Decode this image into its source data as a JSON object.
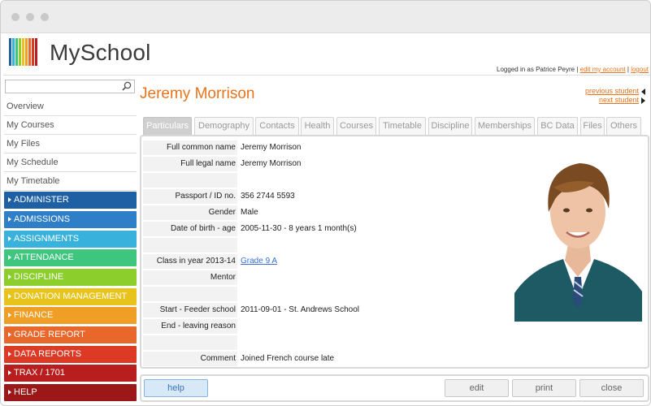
{
  "app": {
    "logo_text": "MySchool"
  },
  "header": {
    "logged_in_text": "Logged in as Patrice Peyre |",
    "edit_account_label": "edit my account",
    "separator": "|",
    "logout_label": "logout"
  },
  "sidebar": {
    "search": {
      "value": "",
      "placeholder": ""
    },
    "plain_items": [
      {
        "label": "Overview"
      },
      {
        "label": "My Courses"
      },
      {
        "label": "My Files"
      },
      {
        "label": "My Schedule"
      },
      {
        "label": "My Timetable"
      }
    ],
    "color_items": [
      {
        "label": "ADMINISTER",
        "color": "#1f5fa4"
      },
      {
        "label": "ADMISSIONS",
        "color": "#2f7fc8"
      },
      {
        "label": "ASSIGNMENTS",
        "color": "#38b2dc"
      },
      {
        "label": "ATTENDANCE",
        "color": "#3ec67f"
      },
      {
        "label": "DISCIPLINE",
        "color": "#8ccf2c"
      },
      {
        "label": "DONATION MANAGEMENT",
        "color": "#e8c31b"
      },
      {
        "label": "FINANCE",
        "color": "#ef9f26"
      },
      {
        "label": "GRADE REPORT",
        "color": "#e8672b"
      },
      {
        "label": "DATA REPORTS",
        "color": "#dd3a26"
      },
      {
        "label": "TRAX / 1701",
        "color": "#b81e1e"
      },
      {
        "label": "HELP",
        "color": "#9c1818"
      }
    ]
  },
  "student": {
    "name": "Jeremy Morrison",
    "previous_label": "previous student",
    "next_label": "next student"
  },
  "tabs": [
    {
      "label": "Particulars",
      "active": true
    },
    {
      "label": "Demography"
    },
    {
      "label": "Contacts"
    },
    {
      "label": "Health"
    },
    {
      "label": "Courses"
    },
    {
      "label": "Timetable"
    },
    {
      "label": "Discipline"
    },
    {
      "label": "Memberships"
    },
    {
      "label": "BC Data"
    },
    {
      "label": "Files"
    },
    {
      "label": "Others"
    }
  ],
  "particulars": {
    "full_common_name": {
      "label": "Full common name",
      "value": "Jeremy Morrison"
    },
    "full_legal_name": {
      "label": "Full legal name",
      "value": "Jeremy Morrison"
    },
    "passport": {
      "label": "Passport / ID no.",
      "value": "356 2744 5593"
    },
    "gender": {
      "label": "Gender",
      "value": "Male"
    },
    "dob_age": {
      "label": "Date of birth - age",
      "value": "2005-11-30 - 8 years 1 month(s)"
    },
    "class_year": {
      "label": "Class in year 2013-14",
      "value": "Grade 9 A"
    },
    "mentor": {
      "label": "Mentor",
      "value": ""
    },
    "start_feeder": {
      "label": "Start - Feeder school",
      "value": "2011-09-01 - St. Andrews School"
    },
    "end_reason": {
      "label": "End - leaving reason",
      "value": ""
    },
    "comment": {
      "label": "Comment",
      "value": "Joined French course late"
    }
  },
  "buttons": {
    "help": "help",
    "edit": "edit",
    "print": "print",
    "close": "close"
  },
  "colors": {
    "accent": "#e8731c",
    "link": "#3a6fd8"
  }
}
